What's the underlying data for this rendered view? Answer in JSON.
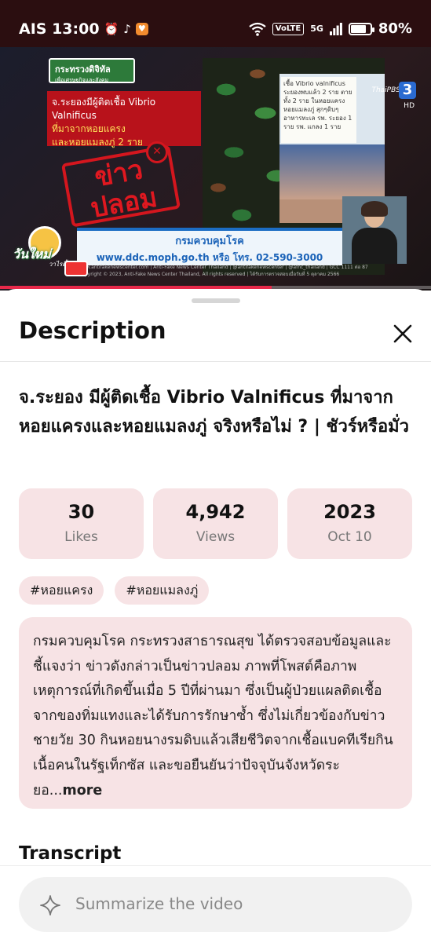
{
  "status_bar": {
    "carrier_time": "AIS 13:00",
    "network_badge": "VoLTE",
    "network_gen": "5G",
    "battery_level": 0.8,
    "battery_pct": "80%",
    "icons": [
      "alarm-icon",
      "tiktok-icon",
      "app-notification-icon",
      "wifi-icon",
      "signal-icon",
      "battery-icon"
    ]
  },
  "video": {
    "ministry_logo": "กระทรวงดิจิทัล",
    "ministry_sub": "เพื่อเศรษฐกิจและสังคม",
    "headline_line1": "จ.ระยองมีผู้ติดเชื้อ Vibrio Valnificus",
    "headline_line2": "ที่มาจากหอยแครง",
    "headline_line3": "และหอยแมลงภู่ 2 ราย",
    "stamp_text_1": "ข่าว",
    "stamp_text_2": "ปลอม",
    "note_text": "เชื้อ Vibrio valnificus ระยองพบแล้ว 2 ราย ตาย ทั้ง 2 ราย ในหอยแครง หอยแมลงภู่ สุกๆดิบๆ อาหารทะเล รพ. ระยอง 1 ราย รพ. แกลง 1 ราย",
    "channel_name": "ThaiPBS",
    "channel_number": "3",
    "channel_hd": "HD",
    "agency_name": "กรมควบคุมโรค",
    "agency_contact": "www.ddc.moph.go.th หรือ โทร. 02-590-3000",
    "footer_line_1": "www.antifakenewscenter.com | Anti-Fake News Center Thailand | @antifakenewscenter | @afnc_thailand | GCC 1111 ต่อ 87",
    "footer_line_2": "Copyright © 2023, Anti-Fake News Center Thailand, All rights reserved | ได้รับการตรวจสอบเมื่อวันที่ 5 ตุลาคม 2566",
    "brand_badge": "วันใหม่",
    "brand_badge_sub": "วาไรตี้",
    "progress": 0.63
  },
  "sheet": {
    "title": "Description",
    "video_title": "จ.ระยอง มีผู้ติดเชื้อ Vibrio Valnificus ที่มาจากหอยแครงและหอยแมลงภู่ จริงหรือไม่ ? | ชัวร์หรือมั่ว",
    "stats": [
      {
        "value": "30",
        "label": "Likes"
      },
      {
        "value": "4,942",
        "label": "Views"
      },
      {
        "value": "2023",
        "label": "Oct 10"
      }
    ],
    "tags": [
      "#หอยแครง",
      "#หอยแมลงภู่"
    ],
    "description": "กรมควบคุมโรค กระทรวงสาธารณสุข ได้ตรวจสอบข้อมูลและชี้แจงว่า ข่าวดังกล่าวเป็นข่าวปลอม ภาพที่โพสต์คือภาพเหตุการณ์ที่เกิดขึ้นเมื่อ 5 ปีที่ผ่านมา ซึ่งเป็นผู้ป่วยแผลติดเชื้อจากของทิ่มแทงและได้รับการรักษาซ้ำ ซึ่งไม่เกี่ยวข้องกับข่าวชายวัย 30 กินหอยนางรมดิบแล้วเสียชีวิตจากเชื้อแบคทีเรียกินเนื้อคนในรัฐเท็กซัส และขอยืนยันว่าปัจจุบันจังหวัดระยอ...",
    "more_label": "more",
    "transcript_heading": "Transcript",
    "summarize_placeholder": "Summarize the video"
  },
  "colors": {
    "accent_pink_bg": "#f7e3e5",
    "progress_red": "#e8294a",
    "status_bar_bg": "#2b0e10"
  }
}
